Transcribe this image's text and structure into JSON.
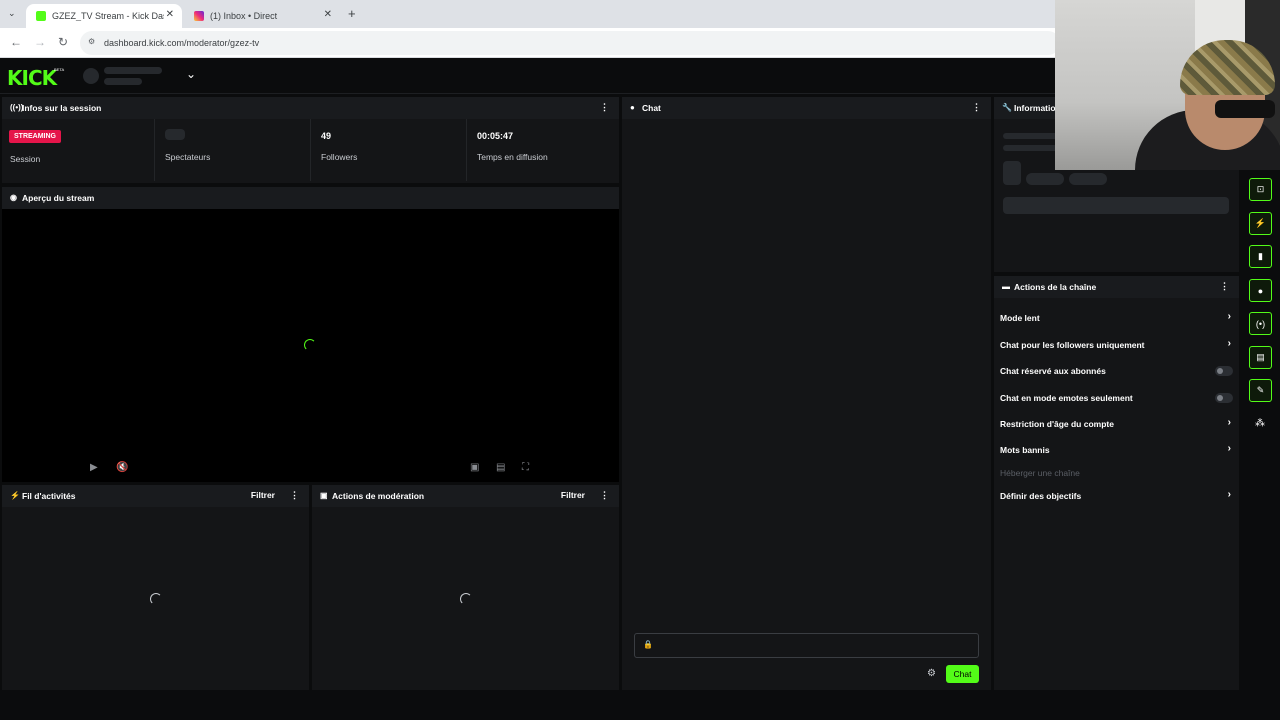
{
  "browser": {
    "tabs": [
      {
        "title": "GZEZ_TV Stream - Kick Dashbo",
        "active": true
      },
      {
        "title": "(1) Inbox • Direct",
        "active": false
      }
    ],
    "new_tab": "+",
    "url": "dashboard.kick.com/moderator/gzez-tv"
  },
  "header": {
    "logo": "KICK",
    "logo_badge": "BETA"
  },
  "session": {
    "title": "Infos sur la session",
    "badge": "STREAMING",
    "stats": [
      {
        "value": "",
        "label": "Session"
      },
      {
        "value": "",
        "label": "Spectateurs"
      },
      {
        "value": "49",
        "label": "Followers"
      },
      {
        "value": "00:05:47",
        "label": "Temps en diffusion"
      }
    ]
  },
  "preview": {
    "title": "Aperçu du stream"
  },
  "activity": {
    "title": "Fil d'activités",
    "filter": "Filtrer"
  },
  "moderation": {
    "title": "Actions de modération",
    "filter": "Filtrer"
  },
  "chat": {
    "title": "Chat",
    "send_label": "Chat"
  },
  "info": {
    "title": "Information"
  },
  "channel_actions": {
    "title": "Actions de la chaîne",
    "items": [
      {
        "label": "Mode lent",
        "control": "chevron"
      },
      {
        "label": "Chat pour les followers uniquement",
        "control": "chevron"
      },
      {
        "label": "Chat réservé aux abonnés",
        "control": "toggle"
      },
      {
        "label": "Chat en mode emotes seulement",
        "control": "toggle"
      },
      {
        "label": "Restriction d'âge du compte",
        "control": "chevron"
      },
      {
        "label": "Mots bannis",
        "control": "chevron"
      },
      {
        "label": "Héberger une chaîne",
        "control": "none"
      },
      {
        "label": "Définir des objectifs",
        "control": "chevron"
      }
    ]
  },
  "colors": {
    "accent": "#53fc18",
    "streaming_badge": "#e5154a",
    "panel": "#141517"
  }
}
